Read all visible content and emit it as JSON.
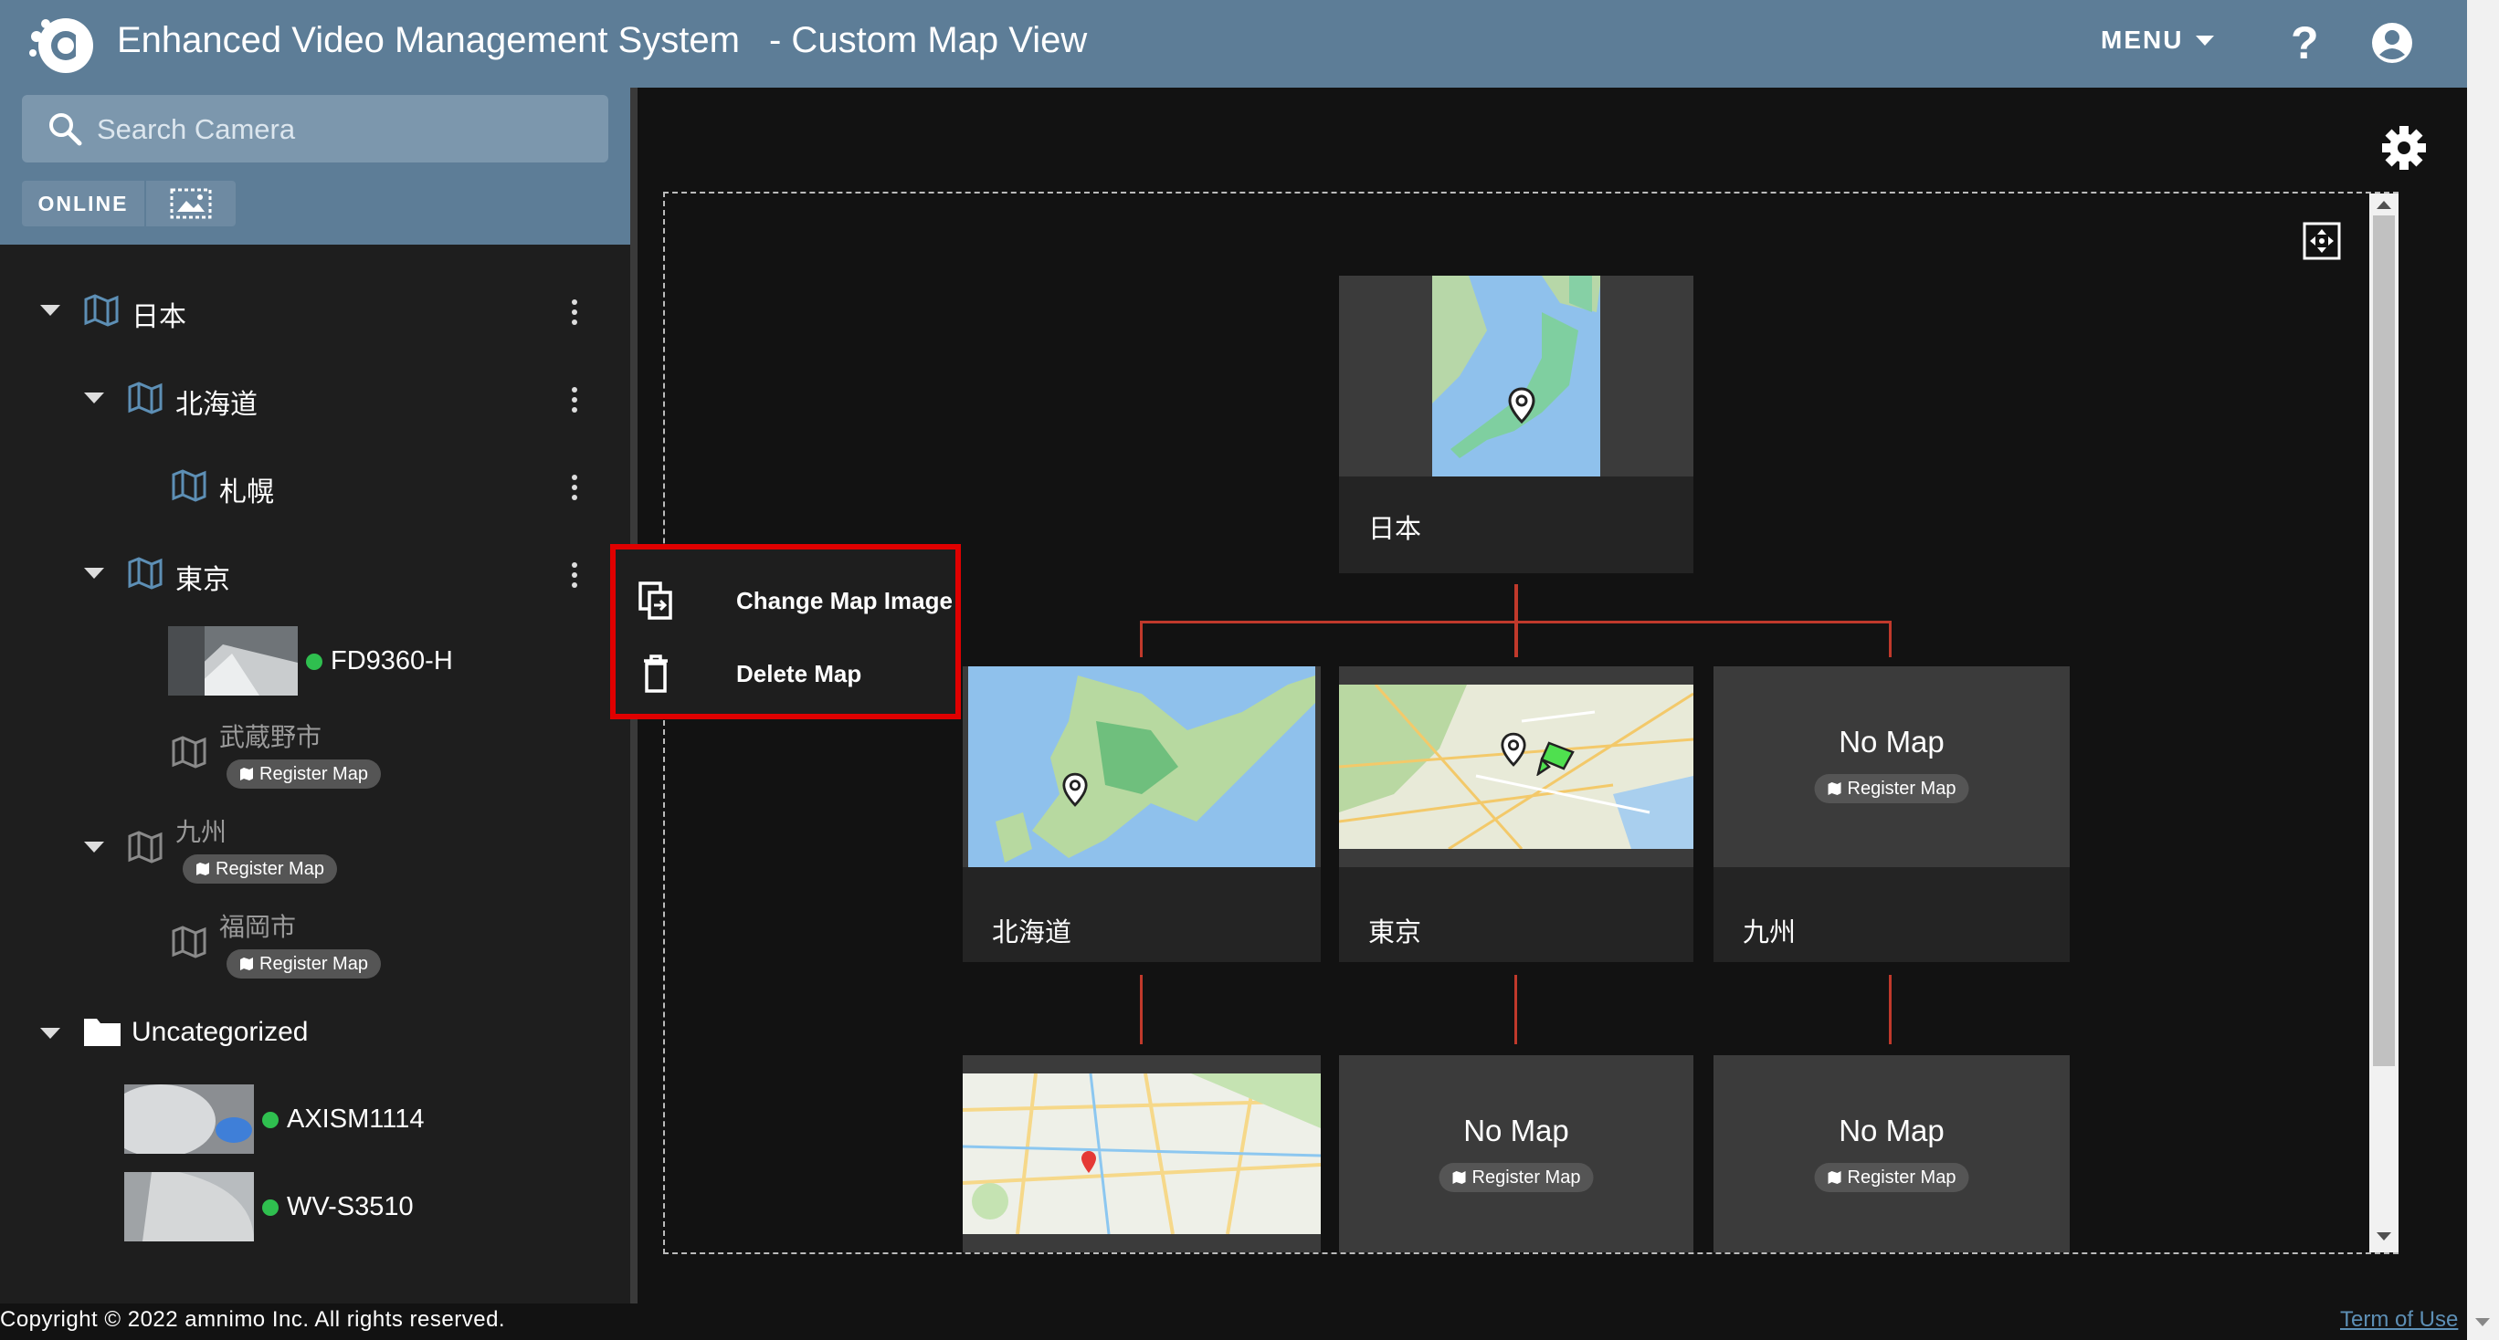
{
  "header": {
    "app_title": "Enhanced Video Management System",
    "subtitle": "- Custom Map View",
    "menu_label": "MENU",
    "help_glyph": "?"
  },
  "search": {
    "placeholder": "Search Camera"
  },
  "filters": {
    "online_label": "ONLINE"
  },
  "tree": {
    "nihon": "日本",
    "hokkaido": "北海道",
    "sapporo": "札幌",
    "tokyo": "東京",
    "fd9360": "FD9360-H",
    "musashino": "武蔵野市",
    "kyushu": "九州",
    "fukuoka": "福岡市",
    "uncategorized": "Uncategorized",
    "axism1114": "AXISM1114",
    "wvs3510": "WV-S3510",
    "register_label": "Register Map"
  },
  "context_menu": {
    "change_image": "Change Map Image",
    "delete_map": "Delete Map"
  },
  "map_nodes": {
    "nihon": "日本",
    "hokkaido": "北海道",
    "tokyo": "東京",
    "kyushu": "九州",
    "no_map": "No Map",
    "register_label": "Register Map"
  },
  "footer": {
    "copyright": "Copyright © 2022 amnimo Inc. All rights reserved.",
    "terms": "Term of Use"
  },
  "colors": {
    "header_bg": "#5d7d97",
    "online_status": "#2fbf4f",
    "connector": "#c0392b",
    "highlight": "#e00000"
  },
  "icons": [
    "logo-icon",
    "chevron-down-icon",
    "help-icon",
    "account-icon",
    "search-icon",
    "image-view-icon",
    "map-icon",
    "kebab-icon",
    "folder-icon",
    "settings-icon",
    "fit-view-icon",
    "copy-icon",
    "trash-icon",
    "location-pin-icon"
  ]
}
